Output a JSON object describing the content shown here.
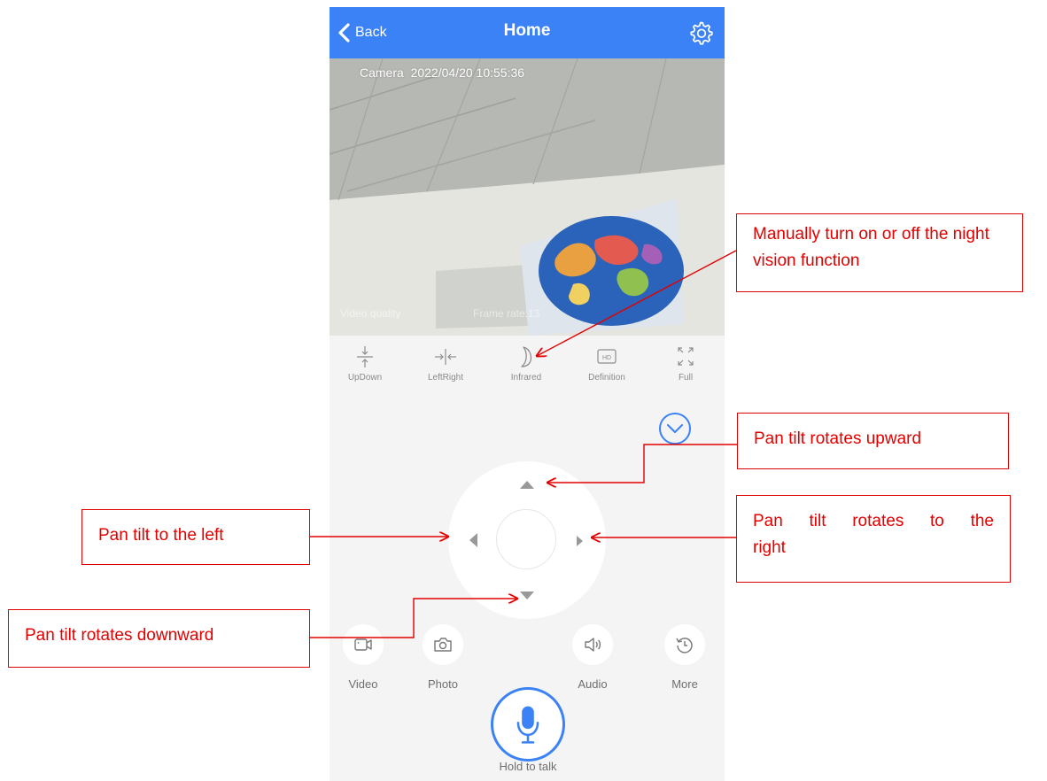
{
  "header": {
    "back_label": "Back",
    "title": "Home"
  },
  "feed": {
    "camera_label": "Camera",
    "timestamp": "2022/04/20 10:55:36",
    "video_quality_label": "Video quality",
    "frame_rate_label": "Frame rate:13"
  },
  "toolbar": [
    {
      "label": "UpDown",
      "icon": "updown-icon"
    },
    {
      "label": "LeftRight",
      "icon": "leftright-icon"
    },
    {
      "label": "Infrared",
      "icon": "moon-icon"
    },
    {
      "label": "Definition",
      "icon": "hd-icon"
    },
    {
      "label": "Full",
      "icon": "fullscreen-icon"
    }
  ],
  "bottom_bar": {
    "video_label": "Video",
    "photo_label": "Photo",
    "talk_label": "Hold to talk",
    "audio_label": "Audio",
    "more_label": "More"
  },
  "annotations": {
    "night_vision": "Manually turn on or off the night vision function",
    "up": "Pan tilt rotates upward",
    "left": "Pan tilt to the left",
    "right_line1": "Pan tilt rotates to the",
    "right_line2": "right",
    "down": "Pan tilt rotates downward"
  },
  "colors": {
    "accent": "#3b82f6",
    "annotation": "#e20000",
    "background": "#f4f4f4"
  }
}
